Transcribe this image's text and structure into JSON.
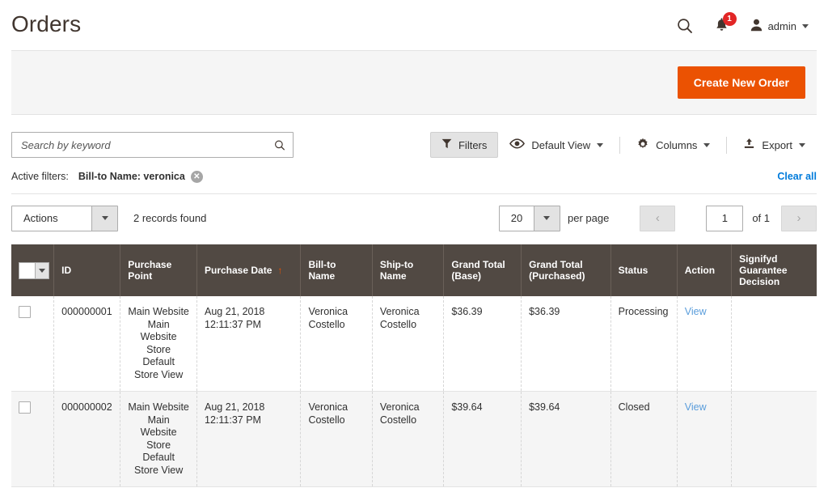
{
  "header": {
    "title": "Orders",
    "search_icon": "search-icon",
    "bell_icon": "notification-bell-icon",
    "notification_count": "1",
    "user_icon": "user-avatar-icon",
    "user_name": "admin"
  },
  "page_actions": {
    "create_new_order": "Create New Order"
  },
  "toolbar": {
    "search_placeholder": "Search by keyword",
    "search_value": "",
    "search_icon": "search-icon",
    "filters_label": "Filters",
    "filters_icon": "funnel-icon",
    "view_label": "Default View",
    "view_icon": "eye-icon",
    "columns_label": "Columns",
    "columns_icon": "gear-icon",
    "export_label": "Export",
    "export_icon": "export-upload-icon"
  },
  "active_filters": {
    "label": "Active filters:",
    "chips": [
      {
        "text": "Bill-to Name: veronica",
        "remove_icon": "remove-filter-icon"
      }
    ],
    "clear_all": "Clear all"
  },
  "grid_controls": {
    "actions_label": "Actions",
    "records_found": "2 records found",
    "per_page_value": "20",
    "per_page_label": "per page",
    "prev_icon": "chevron-left-icon",
    "next_icon": "chevron-right-icon",
    "page_value": "1",
    "of_label": "of 1"
  },
  "grid": {
    "columns": [
      {
        "label": "",
        "name": "select-all"
      },
      {
        "label": "ID",
        "name": "id"
      },
      {
        "label": "Purchase Point",
        "name": "purchase-point"
      },
      {
        "label": "Purchase Date",
        "name": "purchase-date",
        "sorted": "asc",
        "sort_glyph": "↑"
      },
      {
        "label": "Bill-to Name",
        "name": "bill-to-name"
      },
      {
        "label": "Ship-to Name",
        "name": "ship-to-name"
      },
      {
        "label": "Grand Total (Base)",
        "name": "grand-total-base"
      },
      {
        "label": "Grand Total (Purchased)",
        "name": "grand-total-purchased"
      },
      {
        "label": "Status",
        "name": "status"
      },
      {
        "label": "Action",
        "name": "action"
      },
      {
        "label": "Signifyd Guarantee Decision",
        "name": "signifyd-guarantee-decision"
      }
    ],
    "rows": [
      {
        "id": "000000001",
        "purchase_point": "Main Website\nMain\nWebsite Store\nDefault\nStore View",
        "purchase_date": "Aug 21, 2018\n12:11:37 PM",
        "bill_to_name": "Veronica\nCostello",
        "ship_to_name": "Veronica\nCostello",
        "grand_total_base": "$36.39",
        "grand_total_purchased": "$36.39",
        "status": "Processing",
        "action": "View",
        "signifyd": ""
      },
      {
        "id": "000000002",
        "purchase_point": "Main Website\nMain\nWebsite Store\nDefault\nStore View",
        "purchase_date": "Aug 21, 2018\n12:11:37 PM",
        "bill_to_name": "Veronica\nCostello",
        "ship_to_name": "Veronica\nCostello",
        "grand_total_base": "$39.64",
        "grand_total_purchased": "$39.64",
        "status": "Closed",
        "action": "View",
        "signifyd": ""
      }
    ]
  },
  "colors": {
    "accent_orange": "#eb5202",
    "header_brown": "#514943",
    "link_blue": "#007bdb",
    "badge_red": "#e22626"
  }
}
